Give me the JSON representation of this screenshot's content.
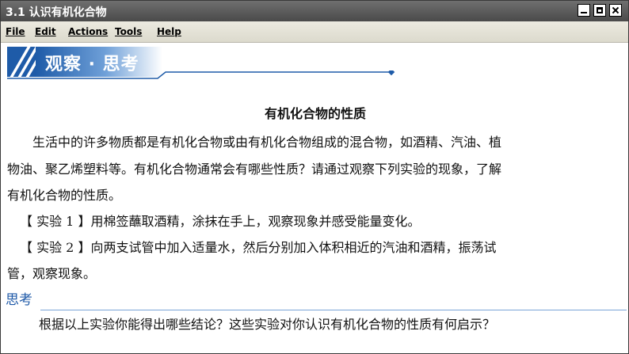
{
  "window": {
    "title": "3.1 认识有机化合物"
  },
  "menu": [
    "File",
    "Edit",
    "Actions",
    "Tools",
    "Help"
  ],
  "section": {
    "title": "观察 · 思考"
  },
  "content": {
    "heading": "有机化合物的性质",
    "para1_line1": "生活中的许多物质都是有机化合物或由有机化合物组成的混合物，如酒精、汽油、植",
    "para1_line2": "物油、聚乙烯塑料等。有机化合物通常会有哪些性质？请通过观察下列实验的现象，了解",
    "para1_line3": "有机化合物的性质。",
    "exp1": "【 实验 1 】用棉签蘸取酒精，涂抹在手上，观察现象并感受能量变化。",
    "exp2_line1": "【 实验 2 】向两支试管中加入适量水，然后分别加入体积相近的汽油和酒精，振荡试",
    "exp2_line2": "管，观察现象。"
  },
  "think": {
    "label": "思考",
    "question": "根据以上实验你能得出哪些结论？这些实验对你认识有机化合物的性质有何启示？"
  },
  "colors": {
    "accent": "#1e5ba8",
    "title_bar": "#555555",
    "menu_bar": "#e4e2d6"
  }
}
